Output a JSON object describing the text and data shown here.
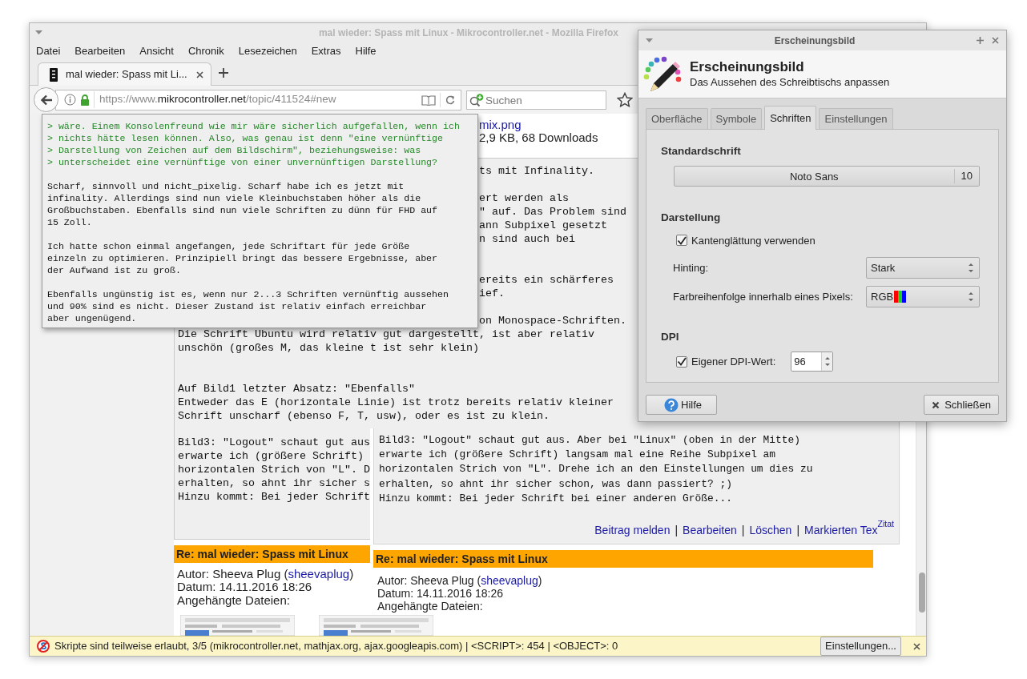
{
  "browser": {
    "title": "mal wieder: Spass mit Linux - Mikrocontroller.net - Mozilla Firefox",
    "menu": [
      "Datei",
      "Bearbeiten",
      "Ansicht",
      "Chronik",
      "Lesezeichen",
      "Extras",
      "Hilfe"
    ],
    "tabs": [
      {
        "label": "mal wieder: Spass mit Li...",
        "selected": true
      }
    ],
    "url": {
      "prefix": "https://www.",
      "domain": "mikrocontroller.net",
      "path": "/topic/411524#new"
    },
    "search": {
      "placeholder": "Suchen"
    },
    "notification": {
      "text": "Skripte sind teilweise erlaubt, 3/5 (mikrocontroller.net, mathjax.org, ajax.googleapis.com) | <SCRIPT>: 454 | <OBJECT>: 0",
      "button": "Einstellungen..."
    }
  },
  "page": {
    "attachment": {
      "link": "mix.png",
      "info": "2,9 KB, 68 Downloads"
    },
    "post": {
      "paragraphs": [
        {
          "lines": [
            {
              "kind": "fragment",
              "text": "ts mit Infinality."
            }
          ]
        },
        {
          "lines": [
            {
              "kind": "fragment",
              "text": "ert werden als"
            },
            {
              "kind": "fragment",
              "text": "\" auf. Das Problem sind"
            },
            {
              "kind": "fragment",
              "text": "ann Subpixel gesetzt"
            },
            {
              "kind": "fragment",
              "text": "n sind auch bei"
            }
          ]
        },
        {
          "lines": [
            {
              "kind": "fragment",
              "text": "ereits ein schärferes"
            },
            {
              "kind": "fragment",
              "text": "ief."
            }
          ]
        },
        {
          "lines": [
            {
              "kind": "fragment",
              "text": "on Monospace-Schriften."
            },
            {
              "kind": "full",
              "text": "Die Schrift Ubuntu wird relativ gut dargestellt, ist aber relativ"
            },
            {
              "kind": "full",
              "text": "unschön (großes M, das kleine t ist sehr klein)"
            }
          ]
        },
        {
          "lines": [
            {
              "kind": "full",
              "text": "Auf Bild1 letzter Absatz: \"Ebenfalls\""
            },
            {
              "kind": "full",
              "text": "Entweder das E (horizontale Linie) ist trotz bereits relativ kleiner"
            },
            {
              "kind": "full",
              "text": "Schrift unscharf (ebenso F, T, usw), oder es ist zu klein."
            }
          ]
        },
        {
          "lines": [
            {
              "kind": "full",
              "text": "Bild3: \"Logout\" schaut gut aus"
            },
            {
              "kind": "full",
              "text": "erwarte ich (größere Schrift)"
            },
            {
              "kind": "full",
              "text": "horizontalen Strich von \"L\". D"
            },
            {
              "kind": "full",
              "text": "erhalten, so ahnt ihr sicher s"
            },
            {
              "kind": "full",
              "text": "Hinzu kommt: Bei jeder Schrift"
            }
          ]
        }
      ]
    },
    "reply": {
      "title": "Re: mal wieder: Spass mit Linux",
      "author_prefix": "Autor: Sheeva Plug (",
      "author_link": "sheevaplug",
      "author_suffix": ")",
      "date": "Datum: 14.11.2016 18:26",
      "attachments_label": "Angehängte Dateien:"
    }
  },
  "quote_overlay": {
    "paragraphs": [
      {
        "kind": "quote",
        "lines": [
          "> wäre. Einem Konsolenfreund wie mir wäre sicherlich aufgefallen, wenn ich",
          "> nichts hätte lesen können. Also, was genau ist denn \"eine vernünftige",
          "> Darstellung von Zeichen auf dem Bildschirm\", beziehungsweise: was",
          "> unterscheidet eine vernünftige von einer unvernünftigen Darstellung?"
        ]
      },
      {
        "kind": "text",
        "lines": [
          "Scharf, sinnvoll und nicht_pixelig. Scharf habe ich es jetzt mit",
          "infinality. Allerdings sind nun viele Kleinbuchstaben höher als die",
          "Großbuchstaben. Ebenfalls sind nun viele Schriften zu dünn für FHD auf",
          "15 Zoll."
        ]
      },
      {
        "kind": "text",
        "lines": [
          "Ich hatte schon einmal angefangen, jede Schriftart für jede Größe",
          "einzeln zu optimieren. Prinzipiell bringt das bessere Ergebnisse, aber",
          "der Aufwand ist zu groß."
        ]
      },
      {
        "kind": "text",
        "lines": [
          "Ebenfalls ungünstig ist es, wenn nur 2...3 Schriften vernünftig aussehen",
          "und 90% sind es nicht. Dieser Zustand ist relativ einfach erreichbar",
          "aber ungenügend."
        ]
      }
    ]
  },
  "post_overlay": {
    "lines": [
      "Bild3: \"Logout\" schaut gut aus. Aber bei \"Linux\" (oben in der Mitte)",
      "erwarte ich (größere Schrift) langsam mal eine Reihe Subpixel am",
      "horizontalen Strich von \"L\". Drehe ich an den Einstellungen um dies zu",
      "erhalten, so ahnt ihr sicher schon, was dann passiert? ;)",
      "Hinzu kommt: Bei jeder Schrift bei einer anderen Größe..."
    ],
    "links": [
      "Beitrag melden",
      "Bearbeiten",
      "Löschen",
      "Markierten Tex"
    ],
    "separator": "|",
    "corner_label": "Zitat",
    "reply": {
      "title": "Re: mal wieder: Spass mit Linux",
      "author_prefix": "Autor: Sheeva Plug (",
      "author_link": "sheevaplug",
      "author_suffix": ")",
      "date": "Datum: 14.11.2016 18:26",
      "attachments_label": "Angehängte Dateien:"
    }
  },
  "dialog": {
    "title": "Erscheinungsbild",
    "heading": "Erscheinungsbild",
    "subtitle": "Das Aussehen des Schreibtischs anpassen",
    "tabs": [
      {
        "label": "Oberfläche",
        "selected": false
      },
      {
        "label": "Symbole",
        "selected": false
      },
      {
        "label": "Schriften",
        "selected": true
      },
      {
        "label": "Einstellungen",
        "selected": false
      }
    ],
    "default_font": {
      "heading": "Standardschrift",
      "font": "Noto Sans",
      "size": "10"
    },
    "rendering": {
      "heading": "Darstellung",
      "antialias": {
        "label": "Kantenglättung verwenden",
        "checked": true
      },
      "hinting": {
        "label": "Hinting:",
        "value": "Stark"
      },
      "subpixel_order": {
        "label": "Farbreihenfolge innerhalb eines Pixels:",
        "value": "RGB"
      }
    },
    "dpi": {
      "heading": "DPI",
      "custom": {
        "label": "Eigener DPI-Wert:",
        "checked": true
      },
      "value": "96"
    },
    "buttons": [
      {
        "kind": "help",
        "label": "Hilfe"
      },
      {
        "kind": "close",
        "label": "Schließen"
      }
    ]
  }
}
